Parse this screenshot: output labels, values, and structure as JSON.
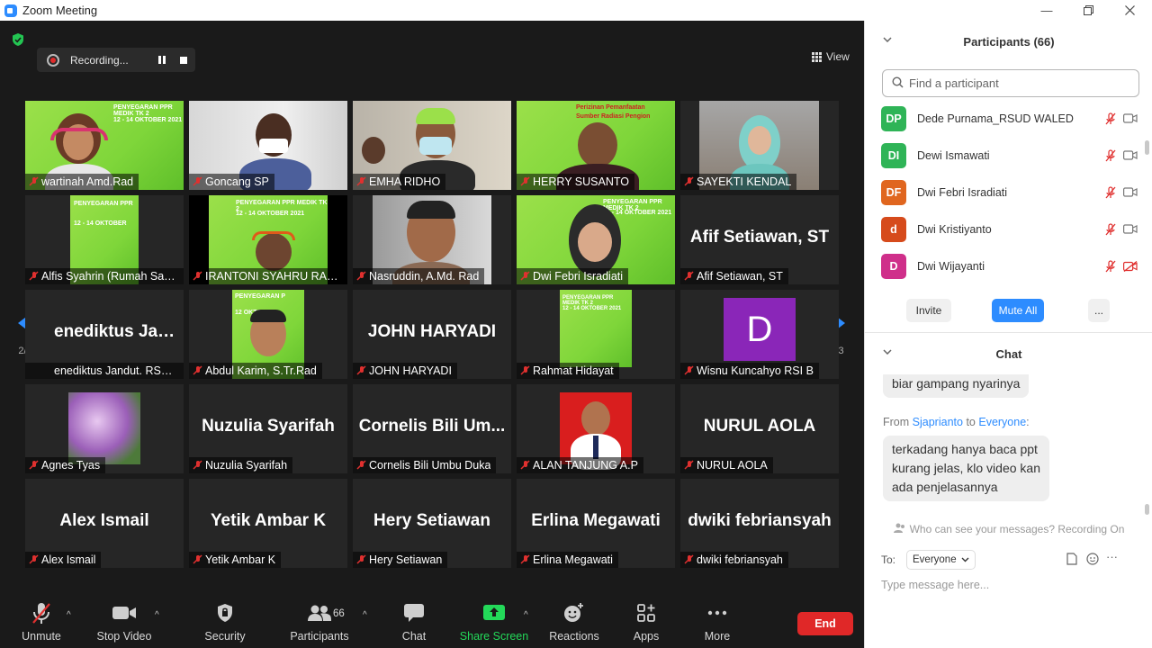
{
  "window": {
    "title": "Zoom Meeting"
  },
  "recording": {
    "label": "Recording..."
  },
  "view": {
    "label": "View"
  },
  "pager": {
    "left": "2/3",
    "right": "2/3"
  },
  "tiles": [
    {
      "label": "wartinah Amd.Rad",
      "big": ""
    },
    {
      "label": "Goncang SP",
      "big": ""
    },
    {
      "label": "EMHA RIDHO",
      "big": ""
    },
    {
      "label": "HERRY SUSANTO",
      "big": ""
    },
    {
      "label": "SAYEKTI KENDAL",
      "big": ""
    },
    {
      "label": "Alfis Syahrin (Rumah Saki...",
      "big": ""
    },
    {
      "label": "IRANTONI SYAHRU RAMA...",
      "big": ""
    },
    {
      "label": "Nasruddin, A.Md. Rad",
      "big": ""
    },
    {
      "label": "Dwi Febri Isradiati",
      "big": ""
    },
    {
      "label": "Afif Setiawan, ST",
      "big": "Afif Setiawan, ST"
    },
    {
      "label": "enediktus Jandut. RSUD ...",
      "big": "enediktus  Jan..."
    },
    {
      "label": "Abdul Karim, S.Tr.Rad",
      "big": ""
    },
    {
      "label": "JOHN HARYADI",
      "big": "JOHN HARYADI"
    },
    {
      "label": "Rahmat Hidayat",
      "big": ""
    },
    {
      "label": "Wisnu Kuncahyo RSI B",
      "big": ""
    },
    {
      "label": "Agnes Tyas",
      "big": ""
    },
    {
      "label": "Nuzulia Syarifah",
      "big": "Nuzulia Syarifah"
    },
    {
      "label": "Cornelis Bili Umbu Duka",
      "big": "Cornelis Bili Um..."
    },
    {
      "label": "ALAN TANJUNG A.P",
      "big": ""
    },
    {
      "label": "NURUL AOLA",
      "big": "NURUL AOLA"
    },
    {
      "label": "Alex Ismail",
      "big": "Alex Ismail"
    },
    {
      "label": "Yetik Ambar K",
      "big": "Yetik Ambar K"
    },
    {
      "label": "Hery Setiawan",
      "big": "Hery Setiawan"
    },
    {
      "label": "Erlina Megawati",
      "big": "Erlina Megawati"
    },
    {
      "label": "dwiki febriansyah",
      "big": "dwiki febriansyah"
    }
  ],
  "slide_text": {
    "t1": "PENYEGARAN PPR MEDIK TK 2",
    "t2": "12 - 14 OKTOBER 2021",
    "t3": "PENYEGARAN PPR",
    "t4": "12 - 14 OKTOBER",
    "t5": "PENYEGARAN PPR MEDIK TK 2",
    "t6": "12 - 14 OKTOBER 2021",
    "t7": "Perizinan Pemanfaatan",
    "t8": "Sumber Radiasi Pengion",
    "t9": "PENYEGARAN P",
    "t10": "12 OKTOBE",
    "t11": "PENYEGARAN PPR MEDIK TK 2",
    "t12": "12 - 14 OKTOBER 2021",
    "t13": "12 - 14 OKTOBER 2021",
    "t14": "PENYEGARAN PPR MEDIK TK 2",
    "avatar_letter": "D"
  },
  "toolbar": {
    "unmute": "Unmute",
    "stop_video": "Stop Video",
    "security": "Security",
    "participants": "Participants",
    "participants_count": "66",
    "chat": "Chat",
    "share": "Share Screen",
    "reactions": "Reactions",
    "apps": "Apps",
    "more": "More",
    "end": "End"
  },
  "panel": {
    "participants_title": "Participants (66)",
    "search_placeholder": "Find a participant",
    "participants": [
      {
        "initials": "DP",
        "name": "Dede Purnama_RSUD WALED",
        "color": "#2fb457",
        "video_off": false
      },
      {
        "initials": "DI",
        "name": "Dewi Ismawati",
        "color": "#2fb457",
        "video_off": false
      },
      {
        "initials": "DF",
        "name": "Dwi Febri Isradiati",
        "color": "#e0661f",
        "video_off": false
      },
      {
        "initials": "d",
        "name": "Dwi Kristiyanto",
        "color": "#d64b1c",
        "video_off": false
      },
      {
        "initials": "D",
        "name": "Dwi Wijayanti",
        "color": "#cf2f8a",
        "video_off": true
      }
    ],
    "invite": "Invite",
    "mute_all": "Mute All",
    "more": "...",
    "chat_title": "Chat",
    "chat_msg1": "biar gampang nyarinya",
    "from_prefix": "From",
    "from_name": "Sjaprianto",
    "to_word": "to",
    "to_name": "Everyone",
    "from_colon": ":",
    "chat_msg2_line1": "terkadang hanya baca ppt",
    "chat_msg2_line2": "kurang jelas, klo video kan",
    "chat_msg2_line3": "ada penjelasannya",
    "who_can_see": "Who can see your messages? Recording On",
    "to_label": "To:",
    "to_value": "Everyone",
    "message_placeholder": "Type message here..."
  },
  "colors": {
    "accent": "#2D8CFF",
    "end": "#E02828",
    "share": "#23D959",
    "muted": "#E0302F"
  }
}
